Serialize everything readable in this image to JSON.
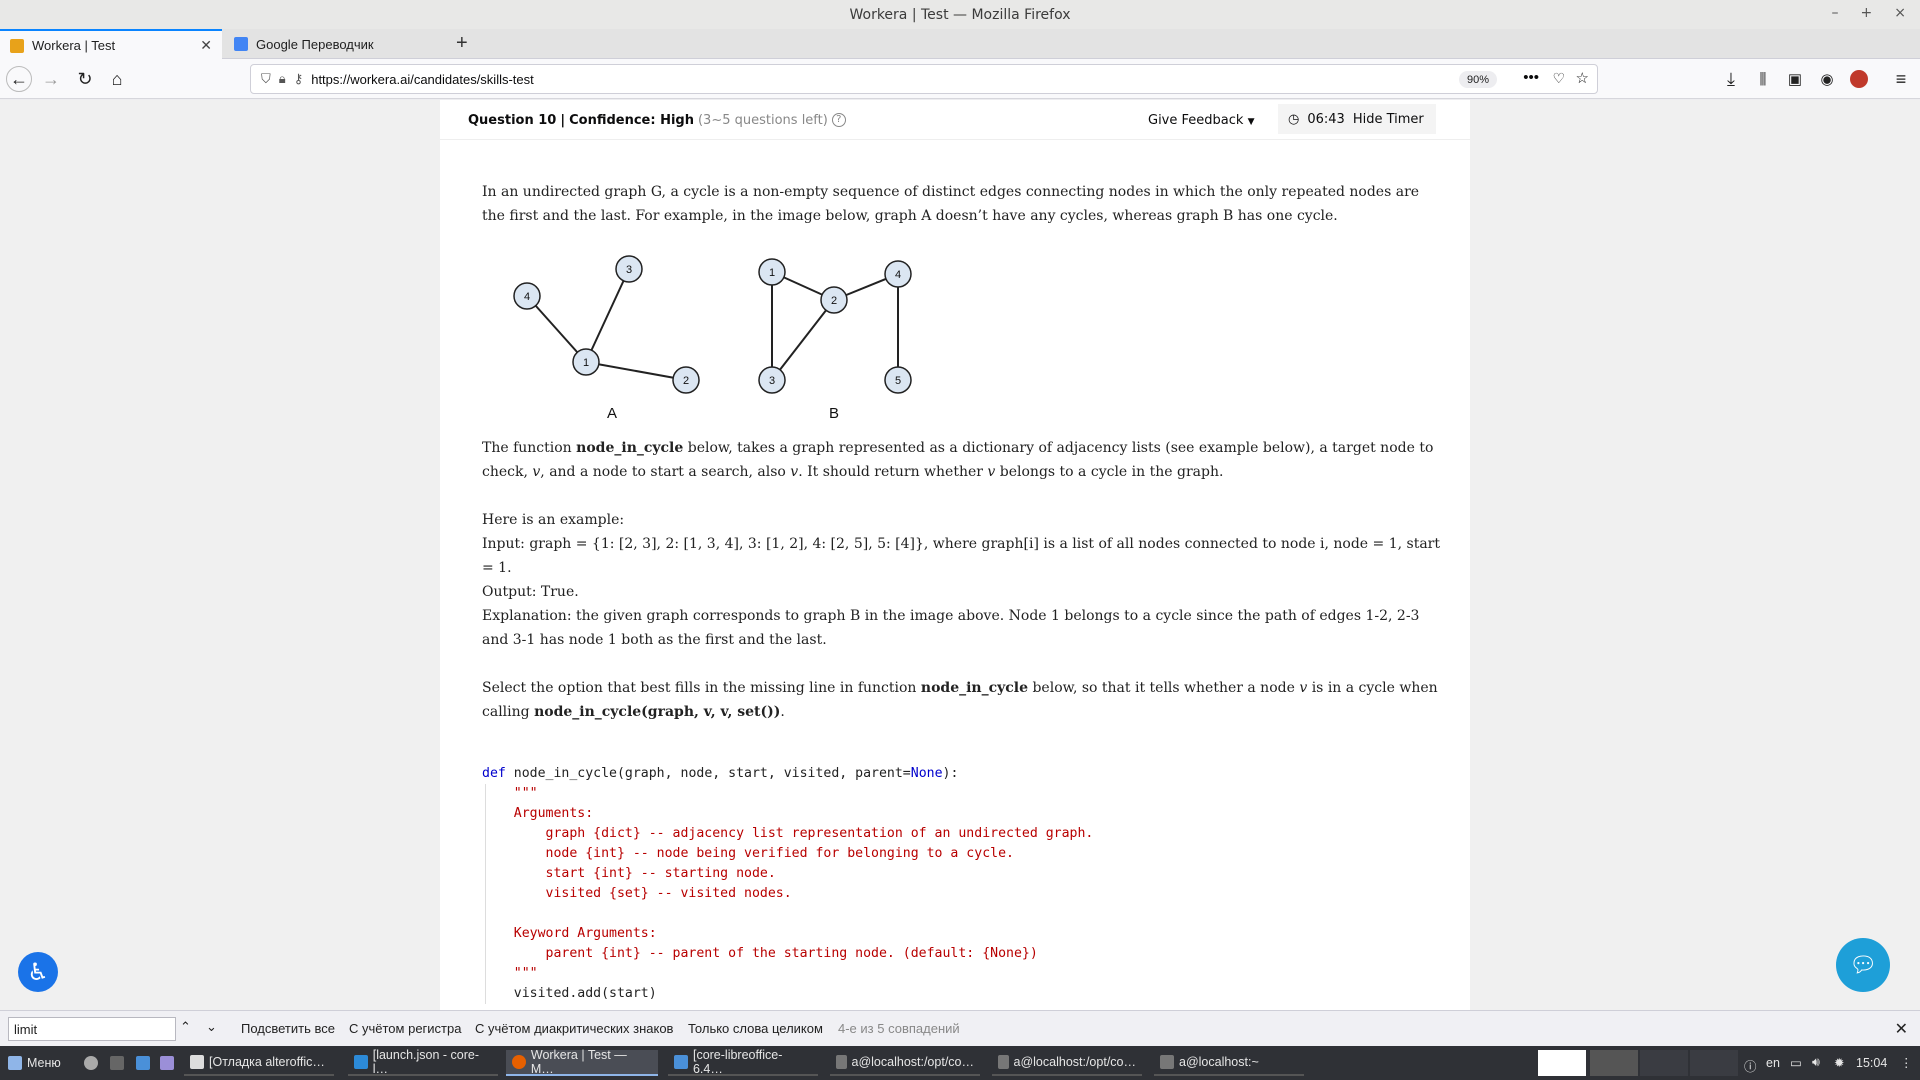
{
  "window": {
    "title": "Workera | Test — Mozilla Firefox"
  },
  "tabs": [
    {
      "label": "Workera | Test",
      "active": true
    },
    {
      "label": "Google Переводчик",
      "active": false
    }
  ],
  "urlbar": {
    "url": "https://workera.ai/candidates/skills-test",
    "zoom": "90%"
  },
  "question": {
    "label": "Question 10",
    "confidence": "Confidence: High",
    "left": "(3~5 questions left)",
    "feedback": "Give Feedback",
    "timer": "06:43",
    "hide_timer": "Hide Timer"
  },
  "body": {
    "p1": "In an undirected graph G, a cycle is a non-empty sequence of distinct edges connecting nodes in which the only repeated nodes are the first and the last. For example, in the image below, graph A doesn’t have any cycles, whereas graph B has one cycle.",
    "graph_a_label": "A",
    "graph_b_label": "B",
    "graph_a_nodes": [
      "4",
      "3",
      "1",
      "2"
    ],
    "graph_b_nodes": [
      "1",
      "2",
      "4",
      "3",
      "5"
    ],
    "p2_pre": "The function",
    "p2_fn": "node_in_cycle",
    "p2_mid": "below, takes a graph represented as a dictionary of adjacency lists (see example below), a target node to check,",
    "p2_v1": "v",
    "p2_mid2": ", and a node to start a search, also",
    "p2_v2": "v",
    "p2_mid3": ". It should return whether",
    "p2_v3": "v",
    "p2_end": "belongs to a cycle in the graph.",
    "ex_title": "Here is an example:",
    "ex_input": "Input: graph = {1: [2, 3], 2: [1, 3, 4], 3: [1, 2], 4: [2, 5], 5: [4]}, where graph[i] is a list of all nodes connected to node i, node = 1, start = 1.",
    "ex_output": "Output: True.",
    "ex_expl": "Explanation: the given graph corresponds to graph B in the image above. Node 1 belongs to a cycle since the path of edges 1-2, 2-3 and 3-1 has node 1 both as the first and the last.",
    "p3_pre": "Select the option that best fills in the missing line in function",
    "p3_fn": "node_in_cycle",
    "p3_mid": "below, so that it tells whether a node",
    "p3_v": "v",
    "p3_mid2": "is in a cycle when calling",
    "p3_call": "node_in_cycle(graph, v, v, set())",
    "p3_end": "."
  },
  "code": {
    "l1_kw": "def",
    "l1_a": " node_in_cycle(graph, node, start, visited, parent=",
    "l1_none": "None",
    "l1_b": "):",
    "l2": "    \"\"\"",
    "l3": "    Arguments:",
    "l4": "        graph {dict} -- adjacency list representation of an undirected graph.",
    "l5": "        node {int} -- node being verified for belonging to a cycle.",
    "l6": "        start {int} -- starting node.",
    "l7": "        visited {set} -- visited nodes.",
    "l8": "",
    "l9": "    Keyword Arguments:",
    "l10": "        parent {int} -- parent of the starting node. (default: {None})",
    "l11": "    \"\"\"",
    "l12": "    visited.add(start)"
  },
  "findbar": {
    "query": "limit",
    "highlight_all": "Подсветить все",
    "match_case": "С учётом регистра",
    "diacritics": "С учётом диакритических знаков",
    "whole_words": "Только слова целиком",
    "status": "4-е из 5 совпадений"
  },
  "taskbar": {
    "menu": "Меню",
    "tasks": [
      "[Отладка alteroffic…",
      "[launch.json - core-l…",
      "Workera | Test — M…",
      "[core-libreoffice-6.4…",
      "a@localhost:/opt/co…",
      "a@localhost:/opt/co…",
      "a@localhost:~"
    ],
    "lang": "en",
    "clock": "15:04"
  },
  "colors": {
    "accent": "#0a84ff",
    "code_keyword": "#0000cc",
    "code_string": "#b80000",
    "node_fill": "#dbe6f2"
  }
}
